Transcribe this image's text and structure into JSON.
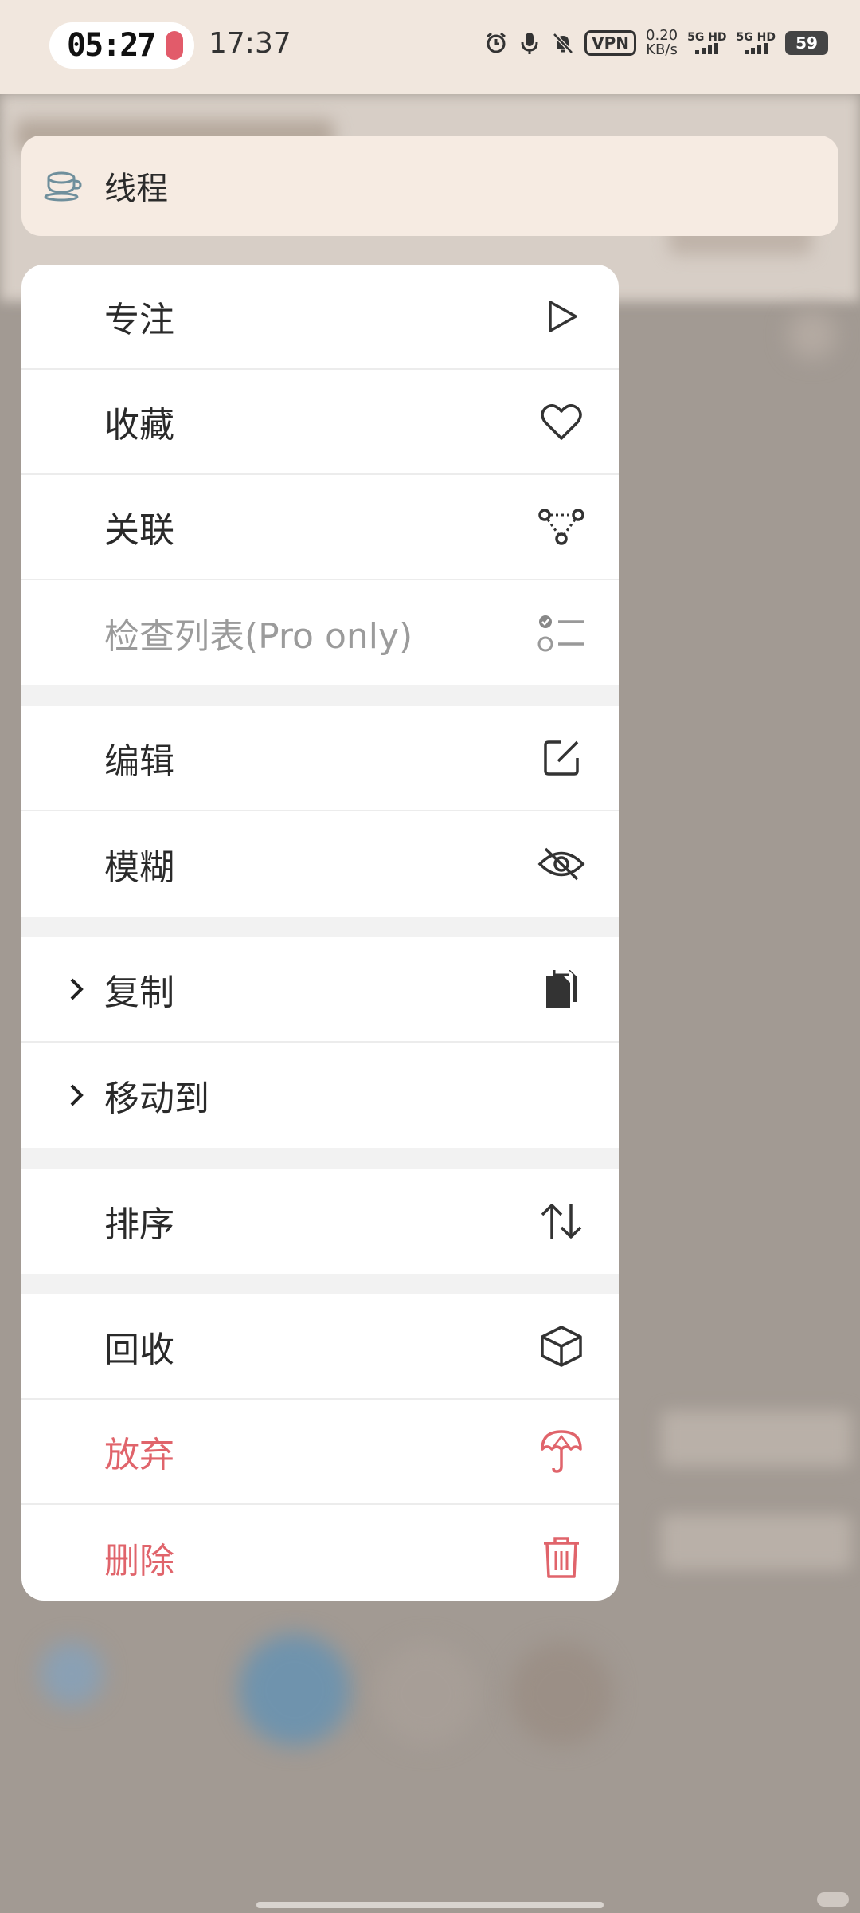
{
  "status_bar": {
    "pill_time": "05:27",
    "clock": "17:37",
    "vpn": "VPN",
    "net_speed_value": "0.20",
    "net_speed_unit": "KB/s",
    "sim1": "5G HD",
    "sim2": "5G HD",
    "battery": "59"
  },
  "header": {
    "title": "线程",
    "icon": "cup-icon"
  },
  "menu": {
    "groups": [
      [
        {
          "label": "专注",
          "icon": "play-icon",
          "state": "normal"
        },
        {
          "label": "收藏",
          "icon": "heart-icon",
          "state": "normal"
        },
        {
          "label": "关联",
          "icon": "link-nodes-icon",
          "state": "normal"
        },
        {
          "label": "检查列表(Pro only)",
          "icon": "checklist-icon",
          "state": "disabled"
        }
      ],
      [
        {
          "label": "编辑",
          "icon": "edit-icon",
          "state": "normal"
        },
        {
          "label": "模糊",
          "icon": "eye-off-icon",
          "state": "normal"
        }
      ],
      [
        {
          "label": "复制",
          "icon": "copy-icon",
          "state": "normal",
          "submenu": true
        },
        {
          "label": "移动到",
          "icon": "",
          "state": "normal",
          "submenu": true
        }
      ],
      [
        {
          "label": "排序",
          "icon": "sort-arrows-icon",
          "state": "normal"
        }
      ],
      [
        {
          "label": "回收",
          "icon": "box-icon",
          "state": "normal"
        },
        {
          "label": "放弃",
          "icon": "umbrella-icon",
          "state": "danger"
        },
        {
          "label": "删除",
          "icon": "trash-icon",
          "state": "danger"
        }
      ]
    ]
  },
  "colors": {
    "danger": "#e0646b",
    "disabled": "#9b9b9b",
    "text": "#2a2a2a",
    "status_bg": "#f1e7de",
    "header_bg": "#f6ebe2"
  }
}
